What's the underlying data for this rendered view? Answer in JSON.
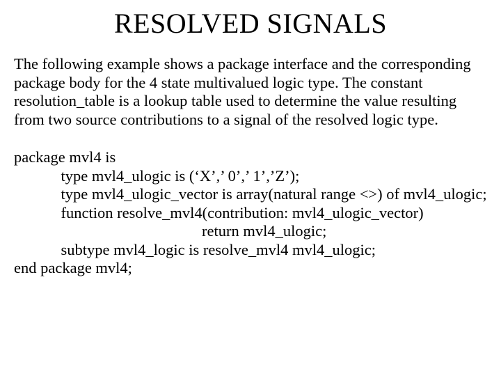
{
  "slide": {
    "title": "RESOLVED SIGNALS",
    "paragraph": "The following example shows a package interface and the corresponding package body for the 4 state multivalued logic type. The constant resolution_table is a lookup table used to determine the value resulting from two source contributions to a signal of the resolved logic type.",
    "code": "package mvl4 is\n            type mvl4_ulogic is (‘X’,’ 0’,’ 1’,’Z’);\n            type mvl4_ulogic_vector is array(natural range <>) of mvl4_ulogic;\n            function resolve_mvl4(contribution: mvl4_ulogic_vector)\n                                                return mvl4_ulogic;\n            subtype mvl4_logic is resolve_mvl4 mvl4_ulogic;\nend package mvl4;"
  }
}
